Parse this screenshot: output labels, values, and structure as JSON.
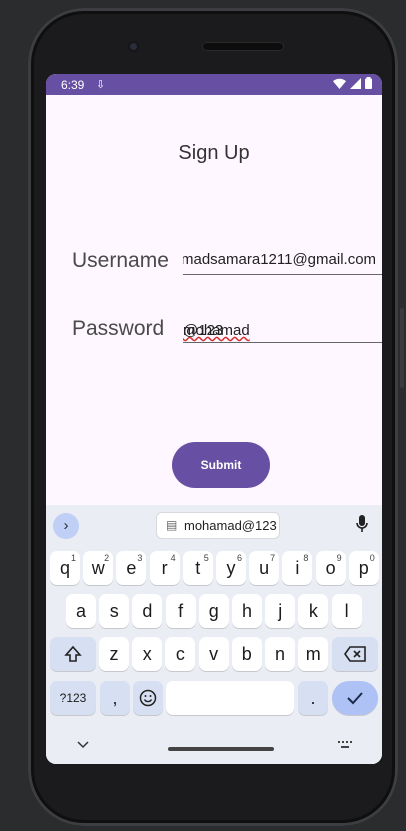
{
  "status_bar": {
    "time": "6:39",
    "download_glyph": "⇩"
  },
  "page": {
    "title": "Sign Up"
  },
  "form": {
    "username_label": "Username",
    "username_value": "madsamara1211@gmail.com",
    "password_label": "Password",
    "password_value_underlined": "mohamad",
    "password_value_rest": "@123",
    "submit_label": "Submit"
  },
  "keyboard": {
    "suggestion": "mohamad@123",
    "row1": [
      {
        "k": "q",
        "s": "1"
      },
      {
        "k": "w",
        "s": "2"
      },
      {
        "k": "e",
        "s": "3"
      },
      {
        "k": "r",
        "s": "4"
      },
      {
        "k": "t",
        "s": "5"
      },
      {
        "k": "y",
        "s": "6"
      },
      {
        "k": "u",
        "s": "7"
      },
      {
        "k": "i",
        "s": "8"
      },
      {
        "k": "o",
        "s": "9"
      },
      {
        "k": "p",
        "s": "0"
      }
    ],
    "row2": [
      "a",
      "s",
      "d",
      "f",
      "g",
      "h",
      "j",
      "k",
      "l"
    ],
    "row3": [
      "z",
      "x",
      "c",
      "v",
      "b",
      "n",
      "m"
    ],
    "sym_label": "?123",
    "comma": ",",
    "period": "."
  }
}
